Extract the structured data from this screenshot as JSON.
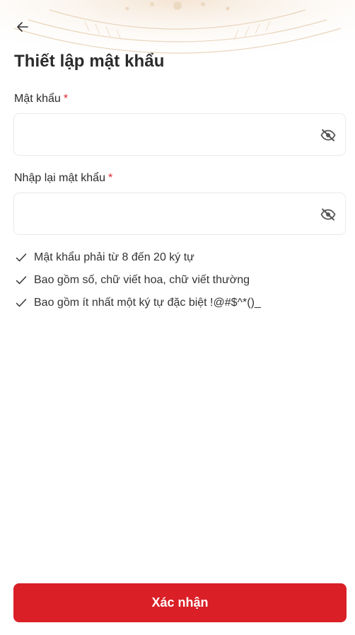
{
  "header": {
    "back_icon": "arrow-left-icon",
    "title": "Thiết lập mật khẩu"
  },
  "form": {
    "password": {
      "label": "Mật khẩu",
      "required_mark": "*",
      "value": "",
      "toggle_icon": "eye-off-icon"
    },
    "confirm_password": {
      "label": "Nhập lại mật khẩu",
      "required_mark": "*",
      "value": "",
      "toggle_icon": "eye-off-icon"
    }
  },
  "requirements": [
    {
      "icon": "check-icon",
      "text": "Mật khẩu phải từ 8 đến 20 ký tự"
    },
    {
      "icon": "check-icon",
      "text": "Bao gồm số, chữ viết hoa, chữ viết thường"
    },
    {
      "icon": "check-icon",
      "text": "Bao gồm ít nhất một ký tự đặc biệt !@#$^*()_"
    }
  ],
  "actions": {
    "confirm_label": "Xác nhận"
  },
  "colors": {
    "primary": "#da1f26",
    "required": "#e0252b",
    "text": "#2b2b2b",
    "border": "#e9e9e9",
    "pattern": "#e9d2b6"
  }
}
